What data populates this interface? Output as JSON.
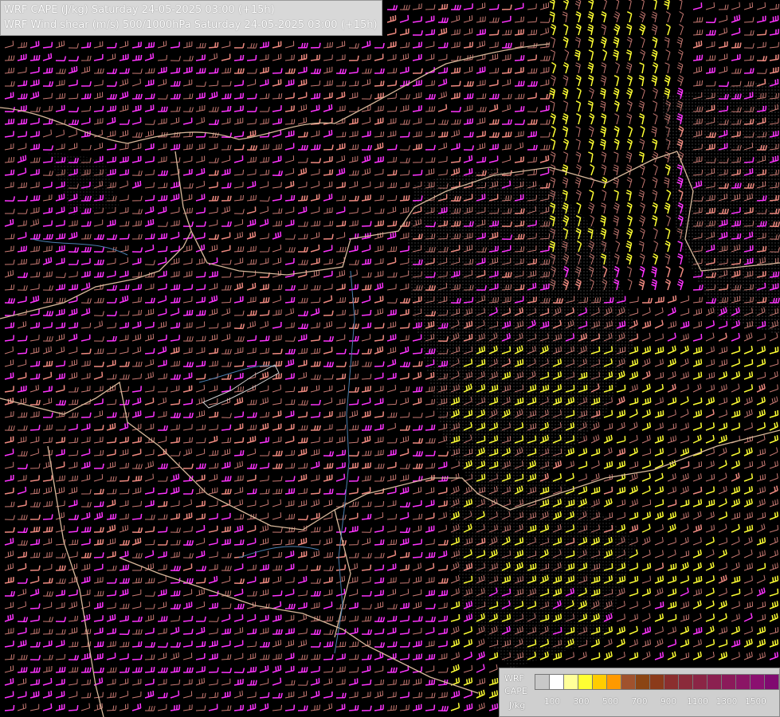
{
  "header": {
    "line1": "WRF CAPE (J/kg) Saturday 24-05-2025 03:00 (+15h)",
    "line2": "WRF Wind shear (m/s) 500/1000hPa Saturday 24-05-2025 03:00 (+15h)"
  },
  "legend": {
    "title_line1": "WRF",
    "title_line2": "CAPE",
    "unit": "J/kg",
    "tick_labels": [
      "100",
      "300",
      "500",
      "700",
      "900",
      "1100",
      "1300",
      "1500"
    ],
    "colors": [
      "#c8c8c8",
      "#ffffff",
      "#ffff99",
      "#ffff33",
      "#ffcc00",
      "#ff9900",
      "#a0522d",
      "#8b4513",
      "#8b3a1a",
      "#8b2e2e",
      "#8b2a3a",
      "#8b2545",
      "#8b2050",
      "#8b1a5a",
      "#8b1565",
      "#8b1070",
      "#800a70"
    ]
  },
  "map": {
    "barb_colors": {
      "low": "#c97a73",
      "mid": "#f08a80",
      "high": "#ff33ff",
      "extreme": "#ffff33"
    },
    "border_color": "#d8b89a",
    "river_color": "#4a7fb0",
    "terrain_color": "#8a7a7a"
  }
}
